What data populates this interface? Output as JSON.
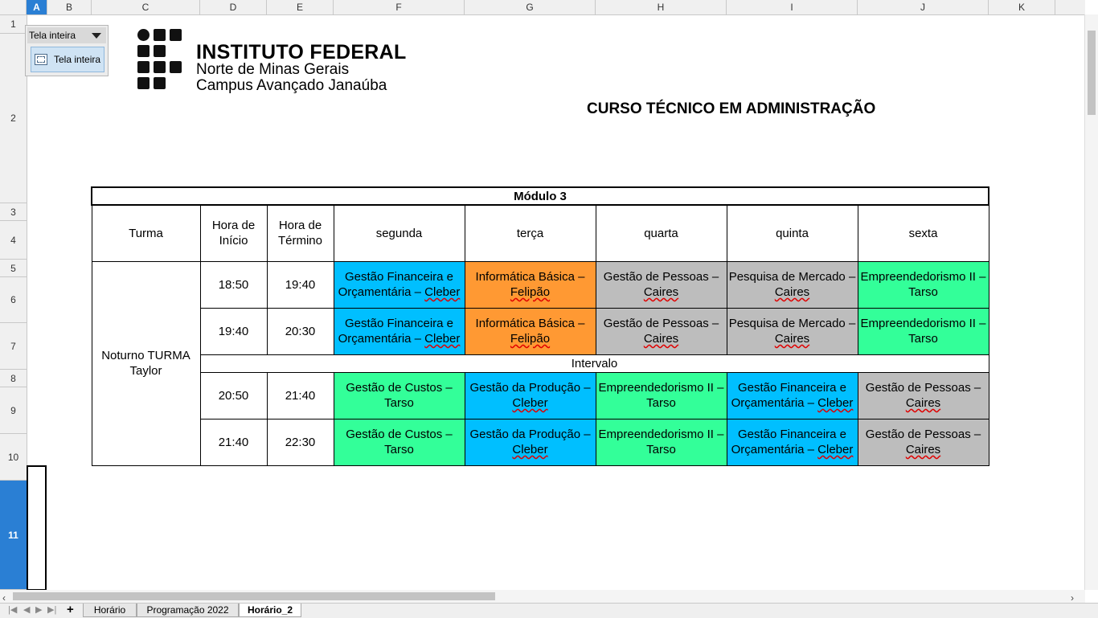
{
  "columns": [
    "A",
    "B",
    "C",
    "D",
    "E",
    "F",
    "G",
    "H",
    "I",
    "J",
    "K"
  ],
  "selected_column": "A",
  "rows": [
    "1",
    "2",
    "3",
    "4",
    "5",
    "6",
    "7",
    "8",
    "9",
    "10",
    "11"
  ],
  "selected_row": "11",
  "fullscreen_toolbar": {
    "title": "Tela inteira",
    "button_label": "Tela inteira"
  },
  "logo": {
    "line1": "INSTITUTO FEDERAL",
    "line2": "Norte de Minas Gerais",
    "line3": "Campus Avançado Janaúba"
  },
  "course_title": "CURSO TÉCNICO EM ADMINISTRAÇÃO",
  "schedule": {
    "module": "Módulo 3",
    "headers": {
      "turma": "Turma",
      "inicio": "Hora de Início",
      "termino": "Hora de Término",
      "days": [
        "segunda",
        "terça",
        "quarta",
        "quinta",
        "sexta"
      ]
    },
    "turma_name": "Noturno TURMA Taylor",
    "break_label": "Intervalo",
    "slots": [
      {
        "start": "18:50",
        "end": "19:40",
        "classes": [
          {
            "subject": "Gestão Financeira e Orçamentária –",
            "teacher": "Cleber",
            "color": "blue"
          },
          {
            "subject": "Informática Básica –",
            "teacher": "Felipão",
            "color": "orange"
          },
          {
            "subject": "Gestão de Pessoas –",
            "teacher": "Caires",
            "color": "gray"
          },
          {
            "subject": "Pesquisa de Mercado –",
            "teacher": "Caires",
            "color": "gray"
          },
          {
            "subject": "Empreendedorismo II –",
            "teacher": "Tarso",
            "color": "green"
          }
        ]
      },
      {
        "start": "19:40",
        "end": "20:30",
        "classes": [
          {
            "subject": "Gestão Financeira e Orçamentária –",
            "teacher": "Cleber",
            "color": "blue"
          },
          {
            "subject": "Informática Básica –",
            "teacher": "Felipão",
            "color": "orange"
          },
          {
            "subject": "Gestão de Pessoas –",
            "teacher": "Caires",
            "color": "gray"
          },
          {
            "subject": "Pesquisa de Mercado –",
            "teacher": "Caires",
            "color": "gray"
          },
          {
            "subject": "Empreendedorismo II –",
            "teacher": "Tarso",
            "color": "green"
          }
        ]
      },
      {
        "start": "20:50",
        "end": "21:40",
        "classes": [
          {
            "subject": "Gestão de Custos –",
            "teacher": "Tarso",
            "color": "green"
          },
          {
            "subject": "Gestão da Produção –",
            "teacher": "Cleber",
            "color": "blue"
          },
          {
            "subject": "Empreendedorismo II –",
            "teacher": "Tarso",
            "color": "green"
          },
          {
            "subject": "Gestão Financeira e Orçamentária –",
            "teacher": "Cleber",
            "color": "blue"
          },
          {
            "subject": "Gestão de Pessoas –",
            "teacher": "Caires",
            "color": "gray"
          }
        ]
      },
      {
        "start": "21:40",
        "end": "22:30",
        "classes": [
          {
            "subject": "Gestão de Custos –",
            "teacher": "Tarso",
            "color": "green"
          },
          {
            "subject": "Gestão da Produção –",
            "teacher": "Cleber",
            "color": "blue"
          },
          {
            "subject": "Empreendedorismo II –",
            "teacher": "Tarso",
            "color": "green"
          },
          {
            "subject": "Gestão Financeira e Orçamentária –",
            "teacher": "Cleber",
            "color": "blue"
          },
          {
            "subject": "Gestão de Pessoas –",
            "teacher": "Caires",
            "color": "gray"
          }
        ]
      }
    ]
  },
  "colors": {
    "blue": "#00bfff",
    "orange": "#ff9933",
    "gray": "#bdbdbd",
    "green": "#33ff99",
    "selection": "#2a7fd4"
  },
  "sheet_tabs": [
    {
      "label": "Horário",
      "active": false
    },
    {
      "label": "Programação 2022",
      "active": false
    },
    {
      "label": "Horário_2",
      "active": true
    }
  ]
}
